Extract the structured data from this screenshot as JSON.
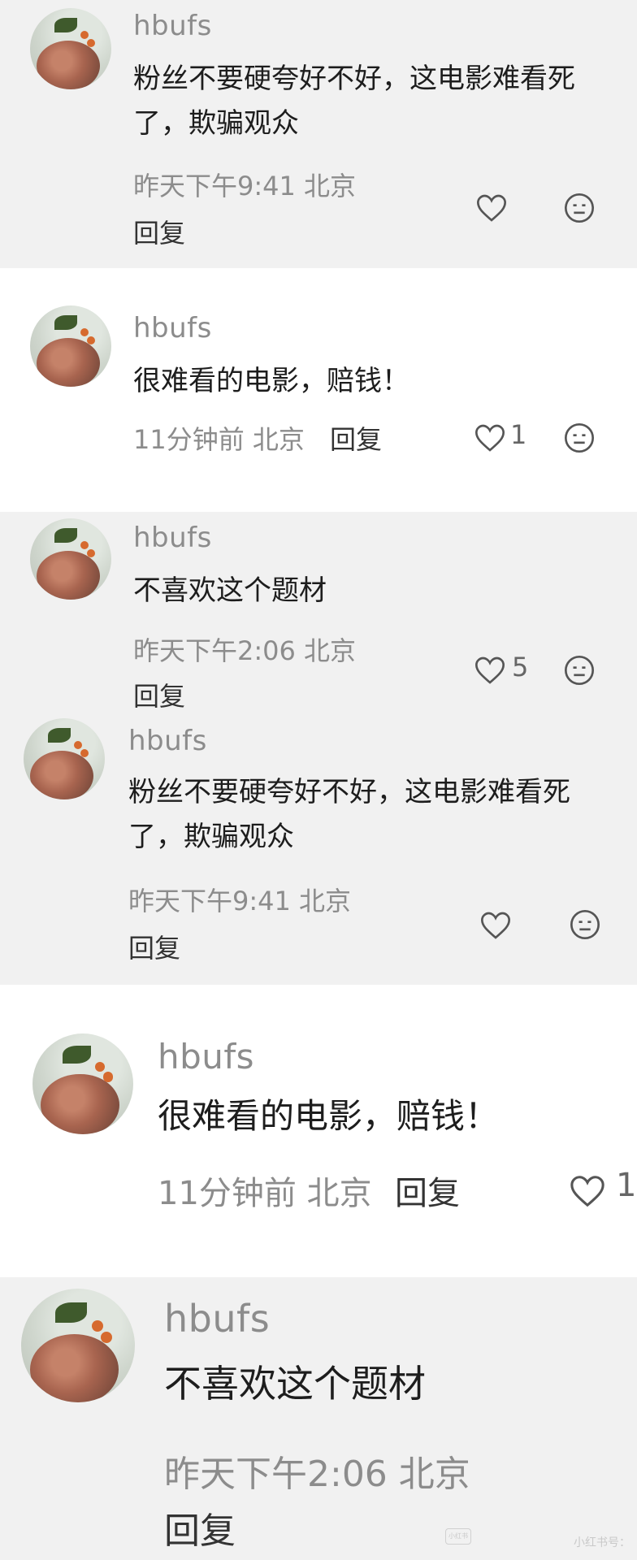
{
  "comments": [
    {
      "username": "hbufs",
      "text": "粉丝不要硬夸好不好，这电影难看死了，欺骗观众",
      "meta": "昨天下午9:41 北京",
      "reply": "回复",
      "likes": ""
    },
    {
      "username": "hbufs",
      "text": "很难看的电影，赔钱！",
      "meta": "11分钟前 北京",
      "reply": "回复",
      "likes": "1"
    },
    {
      "username": "hbufs",
      "text": "不喜欢这个题材",
      "meta": "昨天下午2:06 北京",
      "reply": "回复",
      "likes": "5"
    },
    {
      "username": "hbufs",
      "text": "粉丝不要硬夸好不好，这电影难看死了，欺骗观众",
      "meta": "昨天下午9:41 北京",
      "reply": "回复",
      "likes": ""
    },
    {
      "username": "hbufs",
      "text": "很难看的电影，赔钱！",
      "meta": "11分钟前 北京",
      "reply": "回复",
      "likes": "1"
    },
    {
      "username": "hbufs",
      "text": "不喜欢这个题材",
      "meta": "昨天下午2:06 北京",
      "reply": "回复",
      "likes": ""
    }
  ],
  "watermark": "小红书号：",
  "watermark_logo": "小红书",
  "icons": {
    "like": "heart-icon",
    "dislike": "meh-face-icon"
  },
  "colors": {
    "gray_bg": "#f1f1f1",
    "text": "#1d1d1d",
    "meta": "#8c8c8c"
  }
}
